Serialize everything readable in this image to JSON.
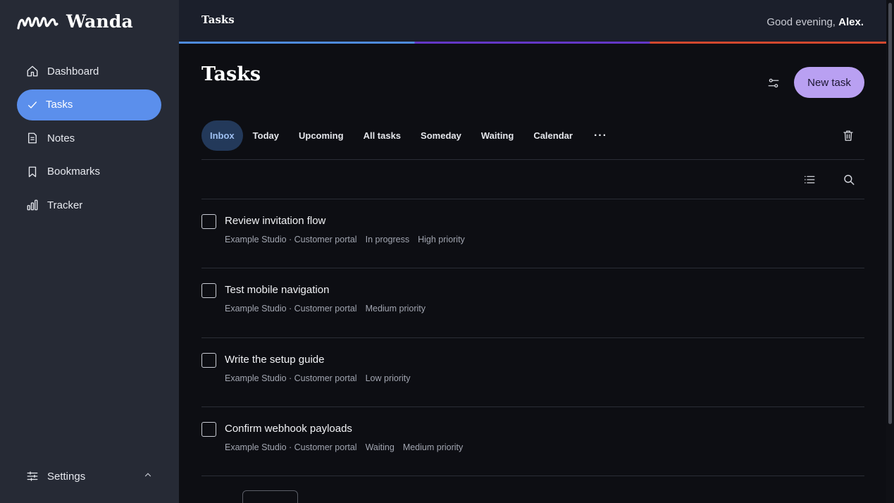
{
  "app": {
    "name": "Wanda"
  },
  "sidebar": {
    "items": [
      {
        "label": "Dashboard",
        "icon": "home-icon"
      },
      {
        "label": "Tasks",
        "icon": "check-icon",
        "active": true
      },
      {
        "label": "Notes",
        "icon": "note-icon"
      },
      {
        "label": "Bookmarks",
        "icon": "bookmark-icon"
      },
      {
        "label": "Tracker",
        "icon": "bar-chart-icon"
      }
    ],
    "settings_label": "Settings"
  },
  "topbar": {
    "title": "Tasks",
    "greeting_prefix": "Good evening,",
    "greeting_name": "Alex."
  },
  "main": {
    "title": "Tasks",
    "new_task_label": "New task",
    "tabs": [
      {
        "label": "Inbox",
        "active": true
      },
      {
        "label": "Today"
      },
      {
        "label": "Upcoming"
      },
      {
        "label": "All tasks"
      },
      {
        "label": "Someday"
      },
      {
        "label": "Waiting"
      },
      {
        "label": "Calendar"
      },
      {
        "label": "···"
      }
    ],
    "tasks": [
      {
        "title": "Review invitation flow",
        "project": "Example Studio · Customer portal",
        "tags": [
          "In progress",
          "High priority"
        ]
      },
      {
        "title": "Test mobile navigation",
        "project": "Example Studio · Customer portal",
        "tags": [
          "Medium priority"
        ]
      },
      {
        "title": "Write the setup guide",
        "project": "Example Studio · Customer portal",
        "tags": [
          "Low priority"
        ]
      },
      {
        "title": "Confirm webhook payloads",
        "project": "Example Studio · Customer portal",
        "tags": [
          "Waiting",
          "Medium priority"
        ]
      }
    ]
  },
  "colors": {
    "accent": "#5b8fec",
    "new_task_button": "#b9a0f2",
    "sidebar_bg": "#262a35",
    "main_bg": "#0d0e13"
  }
}
